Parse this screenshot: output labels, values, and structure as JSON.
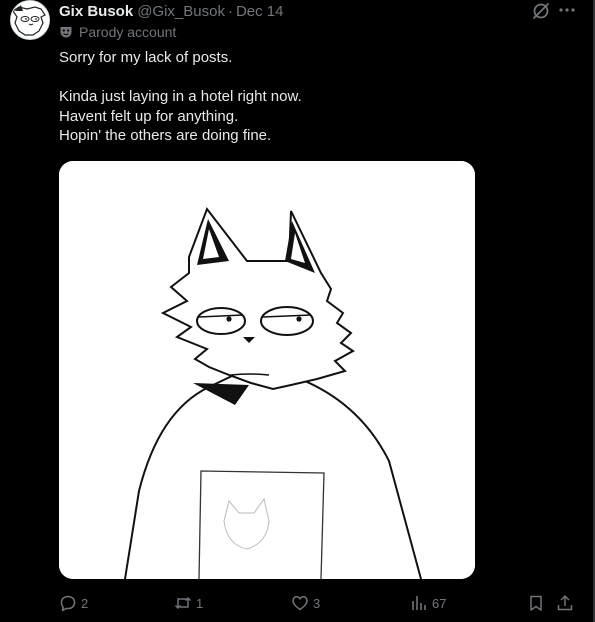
{
  "post": {
    "author": {
      "display_name": "Gix Busok",
      "handle": "@Gix_Busok",
      "separator": "·",
      "date": "Dec 14",
      "label": "Parody account",
      "avatar_icon": "cartoon-dog-avatar"
    },
    "text_lines": {
      "line1": "Sorry for my lack of posts.",
      "line2": "Kinda just laying in a hotel right now.",
      "line3": "Havent felt up for anything.",
      "line4": "Hopin' the others are doing fine."
    },
    "media": {
      "description_icon": "cartoon-wolf-drawing"
    },
    "actions": {
      "replies": "2",
      "reposts": "1",
      "likes": "3",
      "views": "67"
    }
  },
  "colors": {
    "background": "#000000",
    "text_primary": "#e7e9ea",
    "text_secondary": "#71767b",
    "border": "#2f3336"
  }
}
